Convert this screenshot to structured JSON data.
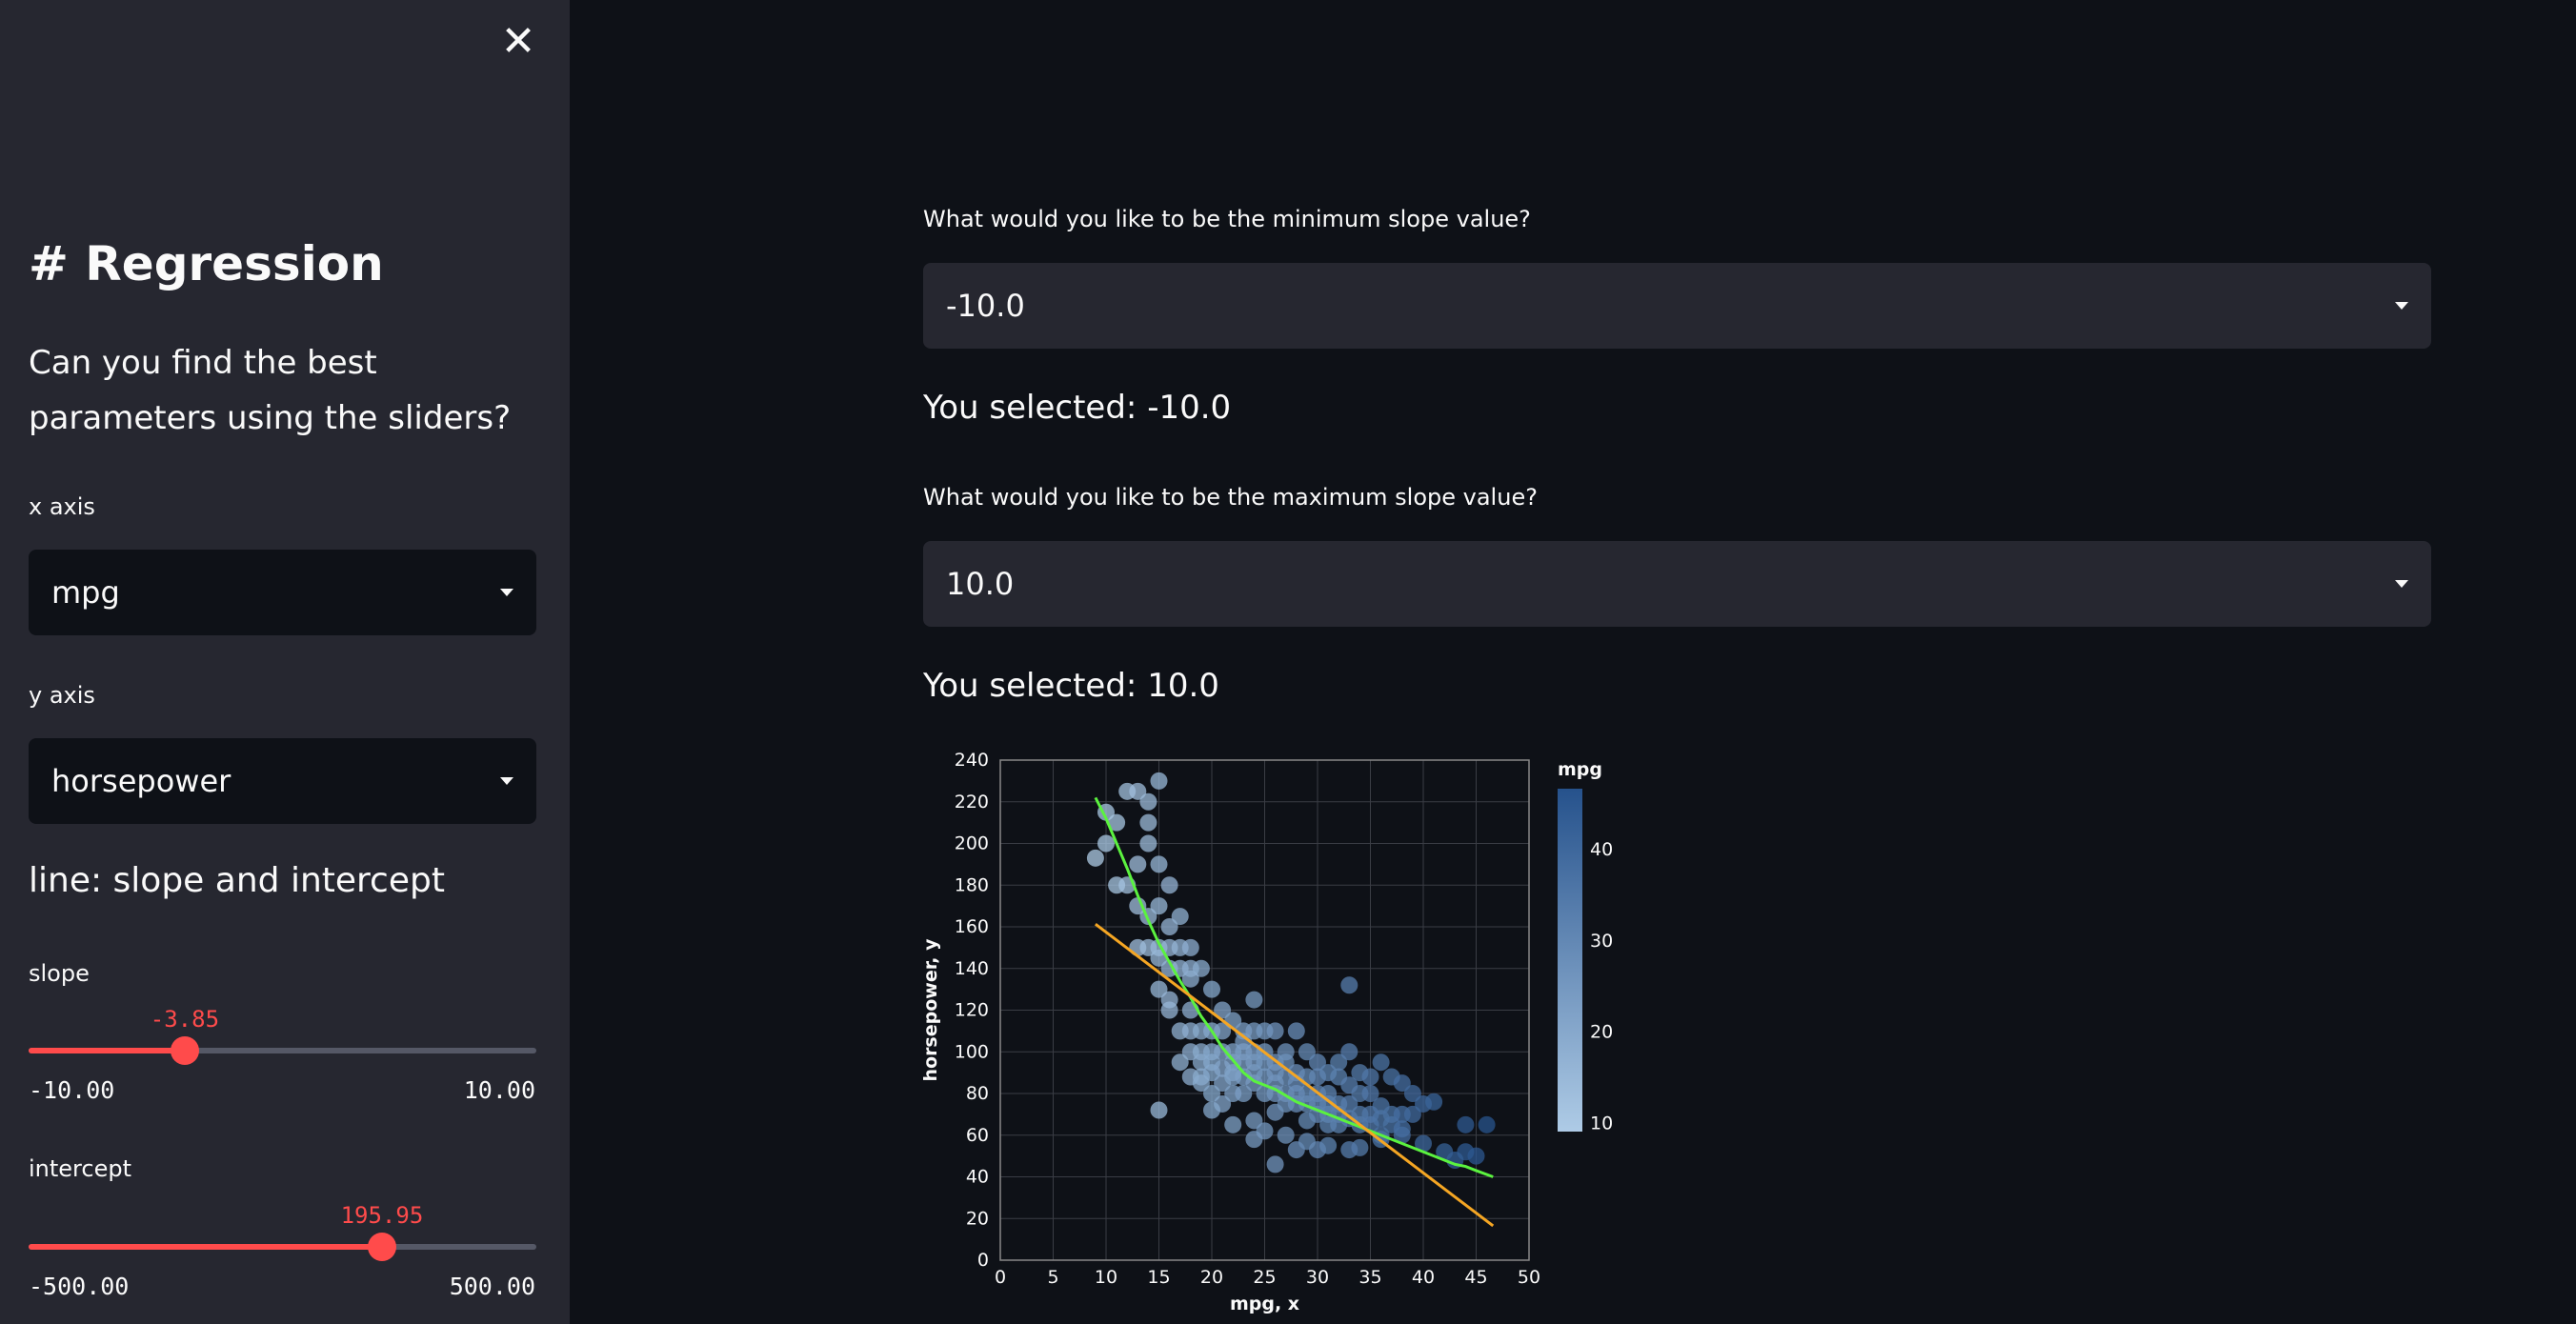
{
  "sidebar": {
    "close_glyph": "✕",
    "heading": "# Regression",
    "prompt": "Can you find the best parameters using the sliders?",
    "x_axis": {
      "label": "x axis",
      "value": "mpg"
    },
    "y_axis": {
      "label": "y axis",
      "value": "horsepower"
    },
    "subheading": "line: slope and intercept",
    "slope": {
      "label": "slope",
      "value": -3.85,
      "value_text": "-3.85",
      "min": -10,
      "max": 10,
      "min_text": "-10.00",
      "max_text": "10.00"
    },
    "intercept": {
      "label": "intercept",
      "value": 195.95,
      "value_text": "195.95",
      "min": -500,
      "max": 500,
      "min_text": "-500.00",
      "max_text": "500.00"
    }
  },
  "main": {
    "min_slope": {
      "label": "What would you like to be the minimum slope value?",
      "value": "-10.0",
      "selected_text": "You selected: -10.0"
    },
    "max_slope": {
      "label": "What would you like to be the maximum slope value?",
      "value": "10.0",
      "selected_text": "You selected: 10.0"
    }
  },
  "colors": {
    "accent": "#ff4b4b",
    "green_line": "#5bf23f",
    "orange_line": "#f5a623",
    "sidebar_bg": "#262730",
    "main_bg": "#0e1117"
  },
  "chart_data": {
    "type": "scatter",
    "xlabel": "mpg, x",
    "ylabel": "horsepower, y",
    "xlim": [
      0,
      50
    ],
    "ylim": [
      0,
      240
    ],
    "xticks": [
      0,
      5,
      10,
      15,
      20,
      25,
      30,
      35,
      40,
      45,
      50
    ],
    "yticks": [
      0,
      20,
      40,
      60,
      80,
      100,
      120,
      140,
      160,
      180,
      200,
      220,
      240
    ],
    "grid": true,
    "color_legend": {
      "title": "mpg",
      "ticks": [
        10,
        20,
        30,
        40
      ],
      "range": [
        9,
        46.6
      ]
    },
    "points": [
      [
        9,
        193
      ],
      [
        10,
        215
      ],
      [
        10,
        200
      ],
      [
        11,
        210
      ],
      [
        11,
        180
      ],
      [
        12,
        225
      ],
      [
        12,
        180
      ],
      [
        13,
        225
      ],
      [
        13,
        190
      ],
      [
        13,
        170
      ],
      [
        13,
        150
      ],
      [
        14,
        220
      ],
      [
        14,
        210
      ],
      [
        14,
        200
      ],
      [
        14,
        165
      ],
      [
        14,
        150
      ],
      [
        15,
        230
      ],
      [
        15,
        190
      ],
      [
        15,
        170
      ],
      [
        15,
        150
      ],
      [
        15,
        145
      ],
      [
        15,
        130
      ],
      [
        16,
        180
      ],
      [
        16,
        160
      ],
      [
        16,
        150
      ],
      [
        16,
        140
      ],
      [
        16,
        120
      ],
      [
        17,
        165
      ],
      [
        17,
        150
      ],
      [
        17,
        140
      ],
      [
        17,
        110
      ],
      [
        18,
        150
      ],
      [
        18,
        140
      ],
      [
        18,
        120
      ],
      [
        18,
        110
      ],
      [
        18,
        100
      ],
      [
        18,
        88
      ],
      [
        19,
        140
      ],
      [
        19,
        110
      ],
      [
        19,
        100
      ],
      [
        19,
        95
      ],
      [
        19,
        88
      ],
      [
        20,
        130
      ],
      [
        20,
        110
      ],
      [
        20,
        100
      ],
      [
        20,
        95
      ],
      [
        20,
        90
      ],
      [
        21,
        120
      ],
      [
        21,
        110
      ],
      [
        21,
        100
      ],
      [
        21,
        85
      ],
      [
        21,
        75
      ],
      [
        22,
        115
      ],
      [
        22,
        100
      ],
      [
        22,
        95
      ],
      [
        22,
        88
      ],
      [
        22,
        80
      ],
      [
        23,
        110
      ],
      [
        23,
        100
      ],
      [
        23,
        95
      ],
      [
        23,
        88
      ],
      [
        23,
        80
      ],
      [
        24,
        125
      ],
      [
        24,
        110
      ],
      [
        24,
        100
      ],
      [
        24,
        95
      ],
      [
        24,
        90
      ],
      [
        24,
        85
      ],
      [
        24,
        67
      ],
      [
        25,
        110
      ],
      [
        25,
        100
      ],
      [
        25,
        95
      ],
      [
        25,
        88
      ],
      [
        25,
        80
      ],
      [
        26,
        110
      ],
      [
        26,
        95
      ],
      [
        26,
        90
      ],
      [
        26,
        80
      ],
      [
        26,
        71
      ],
      [
        27,
        100
      ],
      [
        27,
        95
      ],
      [
        27,
        88
      ],
      [
        27,
        80
      ],
      [
        27,
        75
      ],
      [
        28,
        110
      ],
      [
        28,
        90
      ],
      [
        28,
        80
      ],
      [
        28,
        75
      ],
      [
        29,
        100
      ],
      [
        29,
        88
      ],
      [
        29,
        80
      ],
      [
        29,
        75
      ],
      [
        29,
        67
      ],
      [
        30,
        95
      ],
      [
        30,
        88
      ],
      [
        30,
        80
      ],
      [
        30,
        75
      ],
      [
        30,
        70
      ],
      [
        31,
        90
      ],
      [
        31,
        80
      ],
      [
        31,
        75
      ],
      [
        31,
        70
      ],
      [
        31,
        65
      ],
      [
        32,
        95
      ],
      [
        32,
        88
      ],
      [
        32,
        75
      ],
      [
        32,
        70
      ],
      [
        32,
        65
      ],
      [
        33,
        132
      ],
      [
        33,
        100
      ],
      [
        33,
        84
      ],
      [
        33,
        75
      ],
      [
        33,
        68
      ],
      [
        34,
        90
      ],
      [
        34,
        80
      ],
      [
        34,
        70
      ],
      [
        34,
        65
      ],
      [
        35,
        88
      ],
      [
        35,
        80
      ],
      [
        35,
        70
      ],
      [
        35,
        65
      ],
      [
        36,
        95
      ],
      [
        36,
        74
      ],
      [
        36,
        68
      ],
      [
        36,
        60
      ],
      [
        37,
        88
      ],
      [
        37,
        70
      ],
      [
        37,
        65
      ],
      [
        38,
        85
      ],
      [
        38,
        70
      ],
      [
        38,
        63
      ],
      [
        39,
        80
      ],
      [
        39,
        70
      ],
      [
        40,
        75
      ],
      [
        41,
        76
      ],
      [
        44,
        65
      ],
      [
        44,
        52
      ],
      [
        46,
        65
      ],
      [
        24,
        58
      ],
      [
        28,
        53
      ],
      [
        30,
        53
      ],
      [
        33,
        53
      ],
      [
        26,
        46
      ],
      [
        15,
        72
      ],
      [
        20,
        72
      ],
      [
        22,
        65
      ],
      [
        25,
        62
      ],
      [
        27,
        60
      ],
      [
        29,
        57
      ],
      [
        31,
        55
      ],
      [
        34,
        54
      ],
      [
        36,
        58
      ],
      [
        38,
        60
      ],
      [
        40,
        56
      ],
      [
        42,
        52
      ],
      [
        43,
        48
      ],
      [
        45,
        50
      ],
      [
        18,
        135
      ],
      [
        16,
        125
      ],
      [
        17,
        95
      ],
      [
        19,
        85
      ],
      [
        20,
        80
      ],
      [
        21,
        92
      ],
      [
        22,
        90
      ],
      [
        23,
        105
      ],
      [
        26,
        85
      ],
      [
        28,
        85
      ]
    ],
    "series": [
      {
        "type": "line",
        "color": "#5bf23f",
        "points": [
          [
            9,
            222
          ],
          [
            10,
            212
          ],
          [
            11,
            200
          ],
          [
            12,
            188
          ],
          [
            13,
            175
          ],
          [
            14,
            163
          ],
          [
            15,
            152
          ],
          [
            16,
            143
          ],
          [
            17,
            134
          ],
          [
            18,
            126
          ],
          [
            19,
            117
          ],
          [
            20,
            110
          ],
          [
            21,
            102
          ],
          [
            22,
            96
          ],
          [
            23,
            90
          ],
          [
            24,
            86
          ],
          [
            25,
            84
          ],
          [
            26,
            82
          ],
          [
            27,
            79
          ],
          [
            28,
            76
          ],
          [
            29,
            74
          ],
          [
            30,
            72
          ],
          [
            31,
            70
          ],
          [
            32,
            68
          ],
          [
            33,
            66
          ],
          [
            34,
            64
          ],
          [
            35,
            62
          ],
          [
            36,
            60
          ],
          [
            37,
            58
          ],
          [
            38,
            56
          ],
          [
            39,
            54
          ],
          [
            40,
            52
          ],
          [
            41,
            50
          ],
          [
            42,
            48
          ],
          [
            43,
            46
          ],
          [
            44,
            45
          ],
          [
            45,
            43
          ],
          [
            46.6,
            40
          ]
        ]
      },
      {
        "type": "line",
        "color": "#f5a623",
        "points": [
          [
            9,
            161.3
          ],
          [
            46.6,
            16.5
          ]
        ]
      }
    ]
  }
}
